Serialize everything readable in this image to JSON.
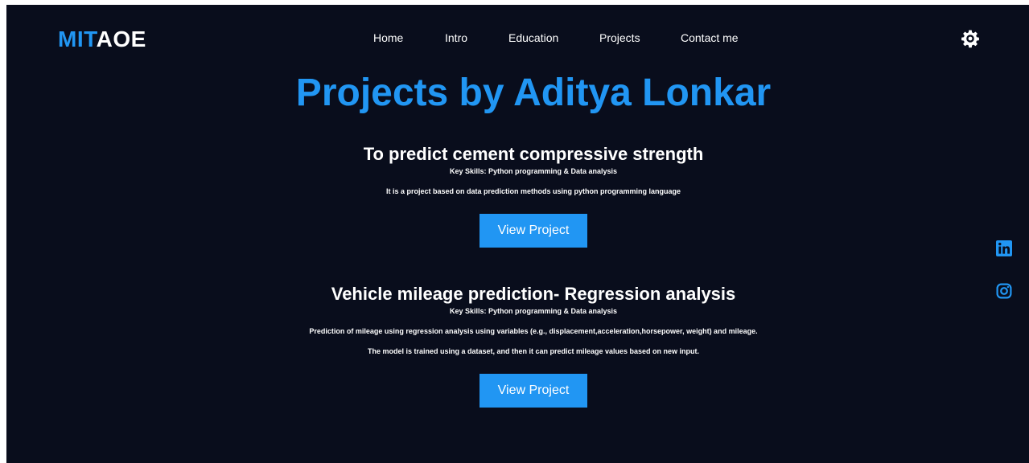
{
  "brand": {
    "part1": "MIT",
    "part2": "AOE"
  },
  "nav": {
    "items": [
      {
        "label": "Home"
      },
      {
        "label": "Intro"
      },
      {
        "label": "Education"
      },
      {
        "label": "Projects"
      },
      {
        "label": "Contact me"
      }
    ]
  },
  "theme_toggle": {
    "icon": "gear-icon"
  },
  "page": {
    "title": "Projects by Aditya Lonkar"
  },
  "projects": [
    {
      "title": "To predict cement compressive strength",
      "skills": "Key Skills: Python programming & Data analysis",
      "description": [
        "It is a project based on data prediction methods using python programming language"
      ],
      "button": "View Project"
    },
    {
      "title": "Vehicle mileage prediction- Regression analysis",
      "skills": "Key Skills: Python programming & Data analysis",
      "description": [
        "Prediction of mileage using regression analysis using variables (e.g., displacement,acceleration,horsepower, weight) and mileage.",
        "The model is trained using a dataset, and then it can predict mileage values based on new input."
      ],
      "button": "View Project"
    }
  ],
  "social": [
    {
      "icon": "linkedin-icon"
    },
    {
      "icon": "instagram-icon"
    }
  ],
  "colors": {
    "background": "#090d1c",
    "accent": "#2196f3",
    "text": "#ffffff"
  }
}
